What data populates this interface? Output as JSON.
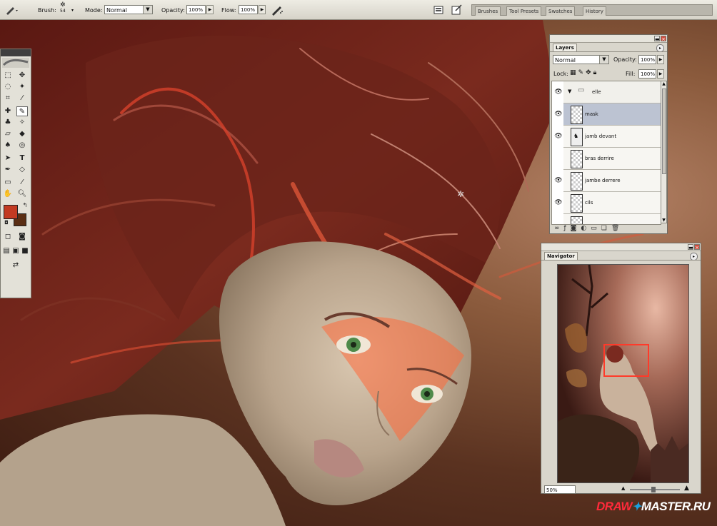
{
  "options_bar": {
    "brush_label": "Brush:",
    "brush_size": "54",
    "mode_label": "Mode:",
    "mode_value": "Normal",
    "opacity_label": "Opacity:",
    "opacity_value": "100%",
    "flow_label": "Flow:",
    "flow_value": "100%",
    "palette_well_tabs": [
      "Brushes",
      "Tool Presets",
      "Swatches",
      "History"
    ]
  },
  "colors": {
    "foreground": "#c23a22",
    "background": "#5a2e14",
    "panel_bg": "#d9d6cc",
    "selected_layer": "#bcc3d2"
  },
  "layers_panel": {
    "tab": "Layers",
    "blend_mode": "Normal",
    "opacity_label": "Opacity:",
    "opacity_value": "100%",
    "lock_label": "Lock:",
    "fill_label": "Fill:",
    "fill_value": "100%",
    "group_name": "elle",
    "layers": [
      {
        "name": "mask",
        "selected": true
      },
      {
        "name": "jamb devant",
        "selected": false
      },
      {
        "name": "bras derrire",
        "selected": false
      },
      {
        "name": "jambe derrere",
        "selected": false
      },
      {
        "name": "cils",
        "selected": false
      }
    ]
  },
  "navigator_panel": {
    "tab": "Navigator",
    "zoom": "50%"
  },
  "watermark": {
    "part1": "DRAW",
    "part2": "MASTER.RU"
  }
}
